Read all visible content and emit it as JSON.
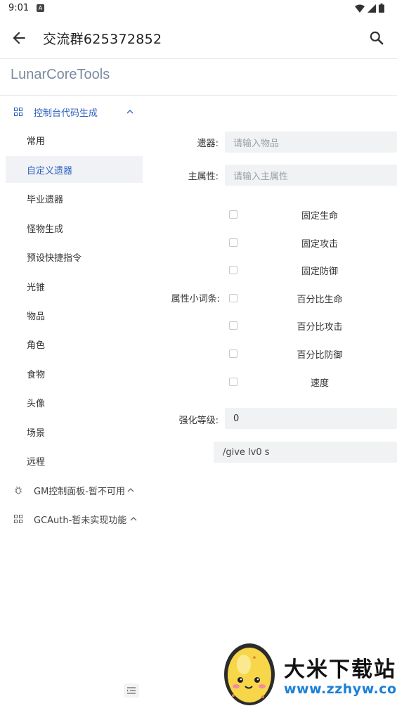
{
  "status_bar": {
    "time": "9:01",
    "notification_badge": "A",
    "icons": [
      "wifi-icon",
      "signal-icon",
      "battery-icon"
    ]
  },
  "app_bar": {
    "title": "交流群625372852",
    "icons": [
      "back-arrow-icon",
      "search-icon"
    ]
  },
  "sidebar": {
    "brand": "LunarCoreTools",
    "groups": [
      {
        "label": "控制台代码生成",
        "icon": "grid-icon",
        "expanded": true,
        "color": "#2d5fbf",
        "items": [
          {
            "label": "常用",
            "active": false
          },
          {
            "label": "自定义遗器",
            "active": true
          },
          {
            "label": "毕业遗器",
            "active": false
          },
          {
            "label": "怪物生成",
            "active": false
          },
          {
            "label": "预设快捷指令",
            "active": false
          },
          {
            "label": "光锥",
            "active": false
          },
          {
            "label": "物品",
            "active": false
          },
          {
            "label": "角色",
            "active": false
          },
          {
            "label": "食物",
            "active": false
          },
          {
            "label": "头像",
            "active": false
          },
          {
            "label": "场景",
            "active": false
          },
          {
            "label": "远程",
            "active": false
          }
        ]
      },
      {
        "label": "GM控制面板-暂不可用",
        "icon": "bug-icon",
        "color": "#444444"
      },
      {
        "label": "GCAuth-暂未实现功能",
        "icon": "grid-icon",
        "color": "#444444"
      }
    ]
  },
  "form": {
    "relic": {
      "label": "遗器:",
      "placeholder": "请输入物品"
    },
    "main_stat": {
      "label": "主属性:",
      "placeholder": "请输入主属性"
    },
    "substats": {
      "label": "属性小词条:",
      "options": [
        {
          "label": "固定生命",
          "checked": false
        },
        {
          "label": "固定攻击",
          "checked": false
        },
        {
          "label": "固定防御",
          "checked": false
        },
        {
          "label": "百分比生命",
          "checked": false
        },
        {
          "label": "百分比攻击",
          "checked": false
        },
        {
          "label": "百分比防御",
          "checked": false
        },
        {
          "label": "速度",
          "checked": false
        }
      ]
    },
    "level": {
      "label": "强化等级:",
      "value": "0"
    },
    "command": "/give  lv0 s"
  },
  "watermark": {
    "title": "大米下载站",
    "url": "www.zzhyw.com"
  },
  "colors": {
    "accent": "#2d5fbf",
    "input_bg": "#f1f2f4",
    "active_item_bg": "#f0f2f5"
  }
}
